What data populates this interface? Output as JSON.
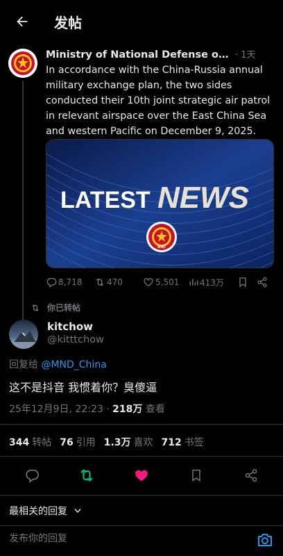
{
  "header": {
    "title": "发帖"
  },
  "quoted_post": {
    "author_name": "Ministry of National Defense of C...",
    "time": "· 1天",
    "text": "In accordance with the China-Russia annual military exchange plan, the two sides conducted their 10th joint strategic air patrol in relevant airspace over the East China Sea and western Pacific on December 9, 2025.",
    "media": {
      "line1": "LATEST",
      "line2": "NEWS",
      "badge_text": "MND"
    },
    "actions": {
      "replies": "8,718",
      "reposts": "470",
      "likes": "5,501",
      "views": "413万"
    }
  },
  "retweet_label": "你已转帖",
  "main_post": {
    "author_name": "kitchow",
    "handle": "@kitttchow",
    "reply_prefix": "回复给 ",
    "reply_mention": "@MND_China",
    "text": "这不是抖音 我惯着你？臭傻逼",
    "timestamp": "25年12月9日, 22:23 · ",
    "views_count": "218万",
    "views_label": " 查看"
  },
  "stats": [
    {
      "count": "344",
      "label": "转帖"
    },
    {
      "count": "76",
      "label": "引用"
    },
    {
      "count": "1.3万",
      "label": "喜欢"
    },
    {
      "count": "712",
      "label": "书签"
    }
  ],
  "sort": {
    "label": "最相关的回复"
  },
  "reply_bar": {
    "placeholder": "发布你的回复"
  },
  "colors": {
    "background": "#000000",
    "text": "#e7e9ea",
    "muted": "#71767b",
    "link": "#1d9bf0",
    "repost_active": "#00ba7c",
    "like_active": "#f91880",
    "divider": "#2f3336"
  }
}
